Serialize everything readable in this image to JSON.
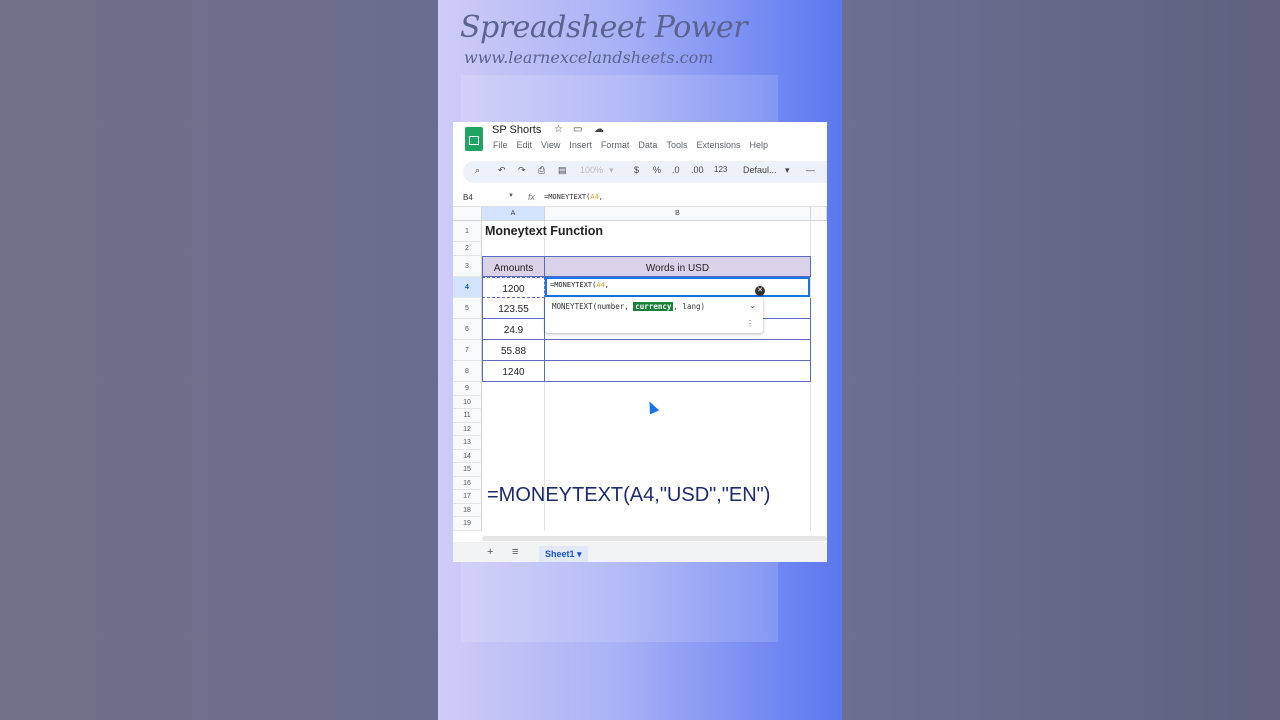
{
  "brand": {
    "title": "Spreadsheet Power",
    "url": "www.learnexcelandsheets.com"
  },
  "app": {
    "doc_title": "SP Shorts",
    "menu": [
      "File",
      "Edit",
      "View",
      "Insert",
      "Format",
      "Data",
      "Tools",
      "Extensions",
      "Help"
    ],
    "toolbar": {
      "zoom": "100%",
      "currency": "$",
      "percent": "%",
      "dec_less": ".0",
      "dec_more": ".00",
      "number_format": "123",
      "font": "Defaul...",
      "minus": "—"
    }
  },
  "formula_bar": {
    "name_box": "B4",
    "fx": "fx",
    "formula_prefix": "=MONEYTEXT(",
    "formula_ref": "A4",
    "formula_suffix": ","
  },
  "grid": {
    "columns": [
      "A",
      "B"
    ],
    "rows": [
      "1",
      "2",
      "3",
      "4",
      "5",
      "6",
      "7",
      "8",
      "9",
      "10",
      "11",
      "12",
      "13",
      "14",
      "15",
      "16",
      "17",
      "18",
      "19"
    ],
    "title_cell": "Moneytext Function",
    "header_amounts": "Amounts",
    "header_words": "Words in USD",
    "amounts": [
      "1200",
      "123.55",
      "24.9",
      "55.88",
      "1240"
    ]
  },
  "editor": {
    "text_prefix": "=MONEYTEXT(",
    "text_ref": "A4",
    "text_suffix": ",",
    "sig_prefix": "MONEYTEXT(number,",
    "sig_highlight": "currency",
    "sig_suffix": ", lang)"
  },
  "overlay_formula": "=MONEYTEXT(A4,\"USD\",\"EN\")",
  "sheet_tab": "Sheet1",
  "colors": {
    "accent": "#1a73e8",
    "header_fill": "#d9d2e9",
    "highlight": "#188038",
    "sheets_green": "#1fa463"
  }
}
